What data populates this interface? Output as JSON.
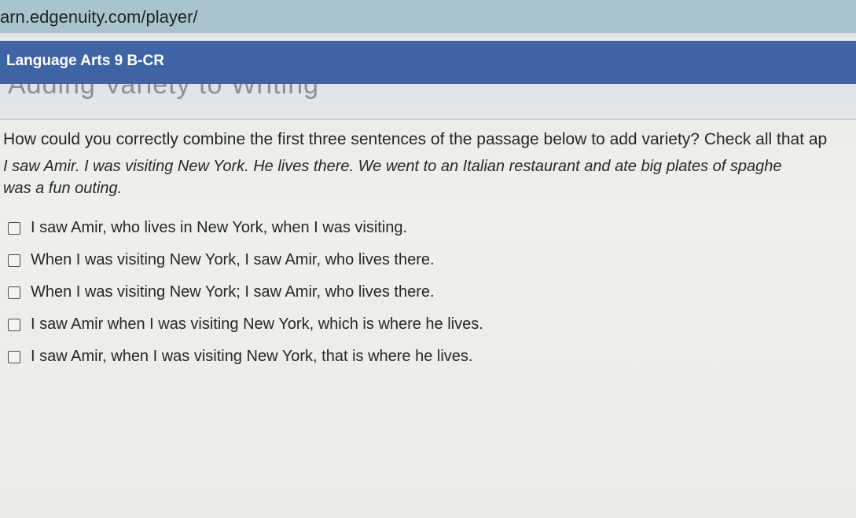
{
  "browser": {
    "url": "arn.edgenuity.com/player/"
  },
  "header": {
    "course_title": "Language Arts 9 B-CR",
    "lesson_title": "Adding Variety to Writing"
  },
  "question": {
    "prompt": "How could you correctly combine the first three sentences of the passage below to add variety? Check all that ap",
    "passage_lines": [
      "I saw Amir. I was visiting New York. He lives there. We went to an Italian restaurant and ate big plates of spaghe",
      "was a fun outing."
    ],
    "options": [
      {
        "label": "I saw Amir, who lives in New York, when I was visiting.",
        "checked": false
      },
      {
        "label": "When I was visiting New York, I saw Amir, who lives there.",
        "checked": false
      },
      {
        "label": "When I was visiting New York; I saw Amir, who lives there.",
        "checked": false
      },
      {
        "label": "I saw Amir when I was visiting New York, which is where he lives.",
        "checked": false
      },
      {
        "label": "I saw Amir, when I was visiting New York, that is where he lives.",
        "checked": false
      }
    ]
  },
  "colors": {
    "course_bar": "#3f64a6",
    "url_bar": "#a9c4cc"
  }
}
